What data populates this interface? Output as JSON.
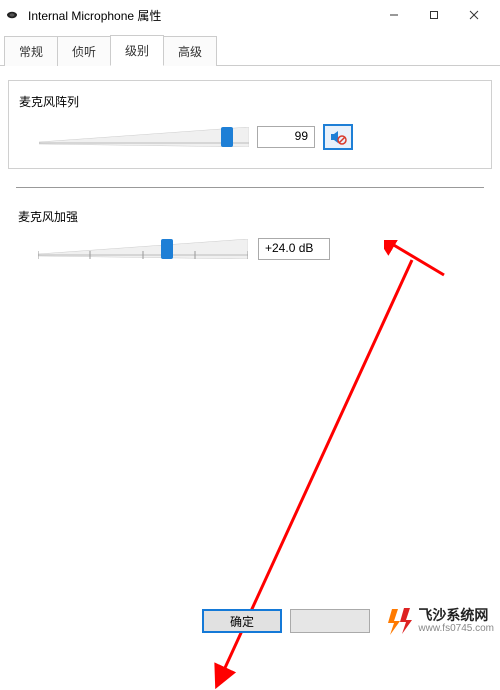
{
  "window": {
    "title": "Internal Microphone 属性"
  },
  "tabs": {
    "general": "常规",
    "listen": "侦听",
    "levels": "级别",
    "advanced": "高级"
  },
  "micArray": {
    "label": "麦克风阵列",
    "value": "99",
    "sliderPercent": 92
  },
  "boost": {
    "label": "麦克风加强",
    "value": "+24.0 dB",
    "sliderPercent": 62
  },
  "buttons": {
    "ok": "确定"
  },
  "watermark": {
    "title": "飞沙系统网",
    "url": "www.fs0745.com"
  }
}
